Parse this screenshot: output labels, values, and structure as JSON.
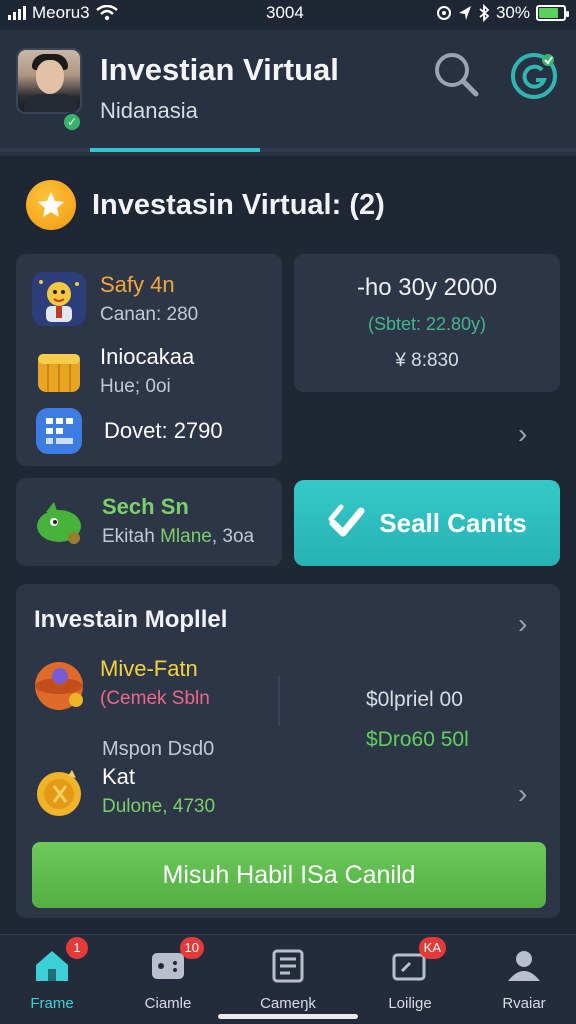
{
  "status_bar": {
    "carrier": "Meoru3",
    "time": "3004",
    "battery": "30%",
    "battery_level": 0.8
  },
  "header": {
    "title": "Investian Virtual",
    "subtitle": "Nidanasia"
  },
  "section": {
    "title": "Investasin Virtual: (2)"
  },
  "holdings": [
    {
      "name": "Safy 4n",
      "detail": "Canan: 280",
      "icon": "mascot-icon"
    },
    {
      "name": "Iniocakaa",
      "detail": "Hue; 0oi",
      "icon": "coin-stack-icon"
    },
    {
      "name": "Dovet: 2790",
      "detail": "",
      "icon": "calculator-icon"
    }
  ],
  "summary": {
    "line1": "-ho 30y 2000",
    "line2": "(Sbtet: 22.80y)",
    "line3": "¥ 8:830"
  },
  "watch_item": {
    "name": "Sech Sn",
    "detail_a": "Ekitah ",
    "detail_b": "Mlane",
    "detail_c": ", 3oa"
  },
  "sell_button": {
    "label": "Seall Canits"
  },
  "model_card": {
    "title": "Investain Mopllel",
    "item1": {
      "name": "Mive-Fatn",
      "detail": "(Cemek Sbln",
      "icon": "ornament-icon"
    },
    "item2_line": "Mspon Dsd0",
    "item3": {
      "name": "Kat",
      "detail": "Dulone, 4730",
      "icon": "gold-coin-icon"
    },
    "value1": "$0lpriel 00",
    "value2": "$Dro60 50l",
    "cta_label": "Misuh Habil ISa Canild"
  },
  "bottom_nav": [
    {
      "label": "Frame",
      "icon": "home-icon",
      "badge": "1",
      "active": true
    },
    {
      "label": "Ciamle",
      "icon": "game-icon",
      "badge": "10",
      "active": false
    },
    {
      "label": "Cameŋk",
      "icon": "wallet-icon",
      "badge": "",
      "active": false
    },
    {
      "label": "Loilige",
      "icon": "card-icon",
      "badge": "KA",
      "active": false
    },
    {
      "label": "Rvaiar",
      "icon": "user-icon",
      "badge": "",
      "active": false
    }
  ],
  "colors": {
    "background": "#1f2634",
    "card": "#2d3647",
    "accent_teal": "#36c3cc",
    "accent_green": "#5fd05f",
    "accent_orange": "#f4a53e"
  }
}
